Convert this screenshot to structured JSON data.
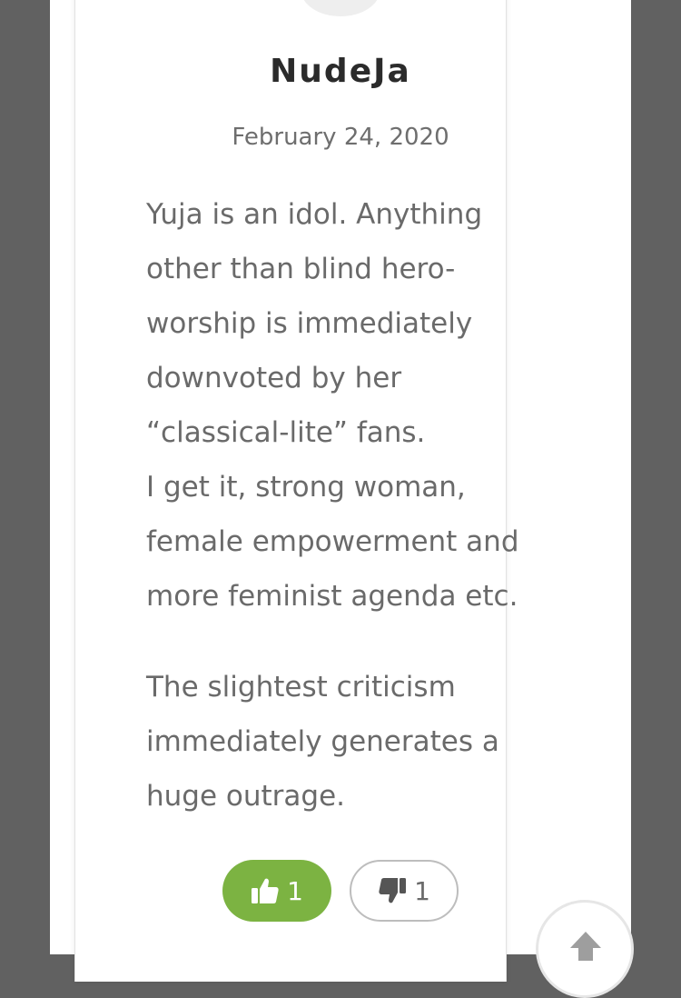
{
  "comment": {
    "author": "NudeJa",
    "date": "February 24, 2020",
    "paragraphs": [
      "Yuja is an idol. Anything other than blind hero-worship is immediately downvoted by her “classical-lite” fans.\nI get it, strong woman, female empowerment and more feminist agenda etc.",
      "The slightest criticism immediately generates a huge outrage."
    ],
    "likes": "1",
    "dislikes": "1"
  },
  "icons": {
    "like": "thumbs-up-icon",
    "dislike": "thumbs-down-icon",
    "scroll_top": "arrow-up-icon"
  },
  "colors": {
    "like_button": "#7cb342",
    "backdrop": "#616161",
    "text": "#6a6a6a"
  }
}
